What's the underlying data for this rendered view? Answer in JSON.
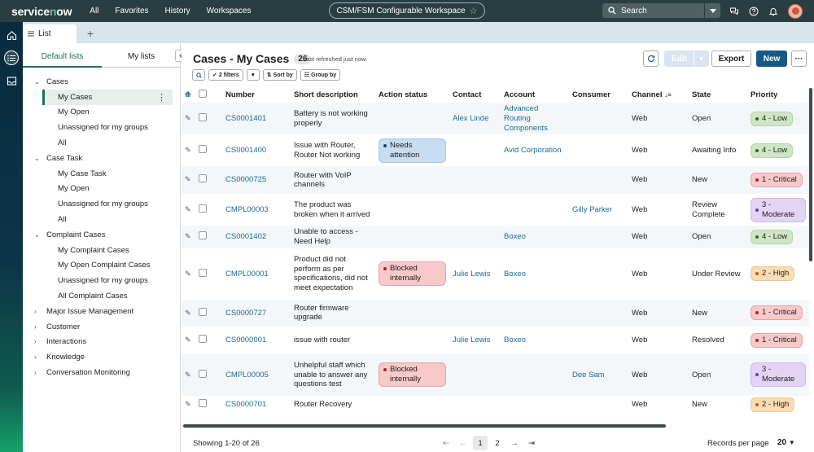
{
  "header": {
    "logo": "servicenow",
    "nav": [
      "All",
      "Favorites",
      "History",
      "Workspaces"
    ],
    "workspace": "CSM/FSM Configurable Workspace",
    "search_placeholder": "Search"
  },
  "tabs": {
    "list_label": "List"
  },
  "lists_panel": {
    "tab_default": "Default lists",
    "tab_my": "My lists",
    "groups": [
      {
        "label": "Cases",
        "expanded": true,
        "children": [
          "My Cases",
          "My Open",
          "Unassigned for my groups",
          "All"
        ]
      },
      {
        "label": "Case Task",
        "expanded": true,
        "children": [
          "My Case Task",
          "My Open",
          "Unassigned for my groups",
          "All"
        ]
      },
      {
        "label": "Complaint Cases",
        "expanded": true,
        "children": [
          "My Complaint Cases",
          "My Open Complaint Cases",
          "Unassigned for my groups",
          "All Complaint Cases"
        ]
      },
      {
        "label": "Major Issue Management",
        "expanded": false,
        "children": []
      },
      {
        "label": "Customer",
        "expanded": false,
        "children": []
      },
      {
        "label": "Interactions",
        "expanded": false,
        "children": []
      },
      {
        "label": "Knowledge",
        "expanded": false,
        "children": []
      },
      {
        "label": "Conversation Monitoring",
        "expanded": false,
        "children": []
      }
    ]
  },
  "main": {
    "title": "Cases - My Cases",
    "count": "26",
    "refreshed": "Last refreshed just now.",
    "btn_edit": "Edit",
    "btn_export": "Export",
    "btn_new": "New",
    "filters_label": "2 filters",
    "sort_label": "Sort by",
    "group_label": "Group by",
    "columns": [
      "Number",
      "Short description",
      "Action status",
      "Contact",
      "Account",
      "Consumer",
      "Channel",
      "State",
      "Priority"
    ],
    "rows": [
      {
        "number": "CS0001401",
        "desc": "Battery is not working properly",
        "action": "",
        "contact": "Alex Linde",
        "account": "Advanced Routing Components",
        "consumer": "",
        "channel": "Web",
        "state": "Open",
        "priority": "4 - Low"
      },
      {
        "number": "CS0001400",
        "desc": "Issue with Router, Router Not working",
        "action": "Needs attention",
        "contact": "",
        "account": "Avid Corporation",
        "consumer": "",
        "channel": "Web",
        "state": "Awaiting Info",
        "priority": "4 - Low"
      },
      {
        "number": "CS0000725",
        "desc": "Router with VoIP channels",
        "action": "",
        "contact": "",
        "account": "",
        "consumer": "",
        "channel": "Web",
        "state": "New",
        "priority": "1 - Critical"
      },
      {
        "number": "CMPL00003",
        "desc": "The product was broken when it arrived",
        "action": "",
        "contact": "",
        "account": "",
        "consumer": "Gilly Parker",
        "channel": "Web",
        "state": "Review Complete",
        "priority": "3 - Moderate"
      },
      {
        "number": "CS0001402",
        "desc": "Unable to access - Need Help",
        "action": "",
        "contact": "",
        "account": "Boxeo",
        "consumer": "",
        "channel": "Web",
        "state": "Open",
        "priority": "4 - Low"
      },
      {
        "number": "CMPL00001",
        "desc": "Product did not perform as per specifications, did not meet expectation",
        "action": "Blocked internally",
        "contact": "Julie Lewis",
        "account": "Boxeo",
        "consumer": "",
        "channel": "Web",
        "state": "Under Review",
        "priority": "2 - High"
      },
      {
        "number": "CS0000727",
        "desc": "Router firmware upgrade",
        "action": "",
        "contact": "",
        "account": "",
        "consumer": "",
        "channel": "Web",
        "state": "New",
        "priority": "1 - Critical"
      },
      {
        "number": "CS0000001",
        "desc": "issue with router",
        "action": "",
        "contact": "Julie Lewis",
        "account": "Boxeo",
        "consumer": "",
        "channel": "Web",
        "state": "Resolved",
        "priority": "1 - Critical"
      },
      {
        "number": "CMPL00005",
        "desc": "Unhelpful staff which unable to answer any questions test",
        "action": "Blocked internally",
        "contact": "",
        "account": "",
        "consumer": "Dee Sam",
        "channel": "Web",
        "state": "Open",
        "priority": "3 - Moderate"
      },
      {
        "number": "CS0000701",
        "desc": "Router Recovery",
        "action": "",
        "contact": "",
        "account": "",
        "consumer": "",
        "channel": "Web",
        "state": "New",
        "priority": "2 - High"
      }
    ]
  },
  "footer": {
    "showing": "Showing 1-20 of 26",
    "pages": [
      "1",
      "2"
    ],
    "current_page": "1",
    "records_label": "Records per page",
    "records_value": "20"
  }
}
